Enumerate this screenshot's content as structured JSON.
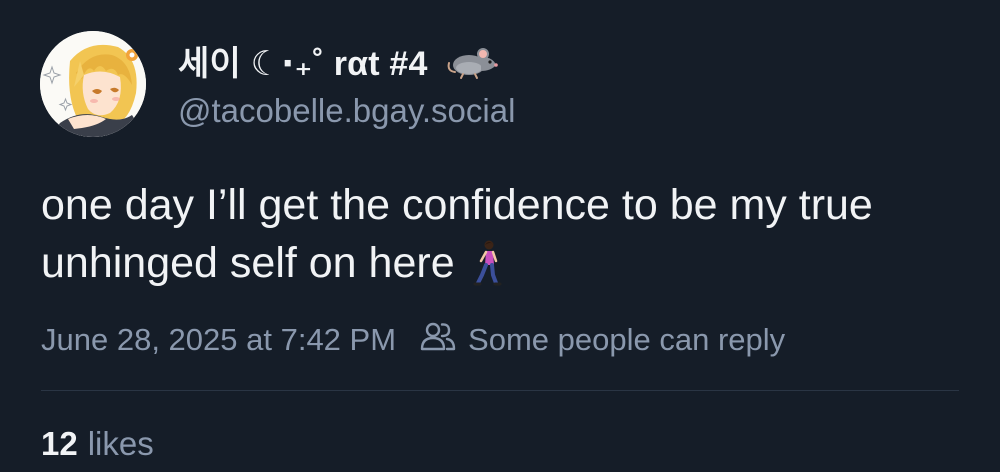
{
  "author": {
    "display_name": "세이 ☾⋅₊˚ rαt #4",
    "handle": "@tacobelle.bgay.social",
    "avatar_icon": "anime-avatar",
    "name_emoji": "rat-icon"
  },
  "post": {
    "text": "one day I’ll get the confidence to be my true unhinged self on here",
    "text_emoji": "person-walking-icon",
    "timestamp": "June 28, 2025 at 7:42 PM",
    "reply_setting": "Some people can reply"
  },
  "engagement": {
    "likes_count": "12",
    "likes_label": "likes"
  },
  "colors": {
    "background": "#151d28",
    "text_primary": "#f1f3f5",
    "text_secondary": "#8a98ad",
    "divider": "#2a3544"
  }
}
